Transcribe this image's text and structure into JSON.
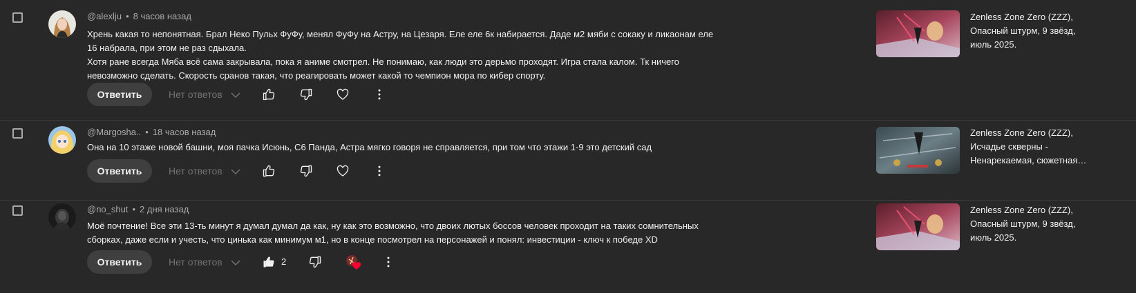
{
  "comments": [
    {
      "author": "@alexlju",
      "time": "8 часов назад",
      "text_lines": [
        "Хрень какая то непонятная. Брал Неко Пульх ФуФу, менял ФуФу на Астру, на Цезаря. Еле еле 6к набирается. Даде м2 мяби с сокаку и ликаонам еле 16 набрала, при этом не раз сдыхала.",
        "Хотя ране всегда Мяба всё сама закрывала, пока я аниме смотрел. Не понимаю, как люди это дерьмо проходят. Игра стала калом. Тк ничего невозможно сделать. Скорость сранов такая, что реагировать может какой то чемпион мора по кибер спорту."
      ],
      "reply_label": "Ответить",
      "replies_label": "Нет ответов",
      "video_title": "Zenless Zone Zero (ZZZ), Опасный штурм, 9 звёзд, июль 2025."
    },
    {
      "author": "@Margosha..",
      "time": "18 часов назад",
      "text_lines": [
        "Она на 10 этаже новой башни, моя пачка Исюнь, С6 Панда, Астра мягко говоря не справляется, при том что этажи 1-9 это детский сад"
      ],
      "reply_label": "Ответить",
      "replies_label": "Нет ответов",
      "video_title": "Zenless Zone Zero (ZZZ), Исчадье скверны - Ненарекаемая, сюжетная…"
    },
    {
      "author": "@no_shut",
      "time": "2 дня назад",
      "text_lines": [
        "Моё почтение! Все эти 13-ть минут я думал думал да как, ну как это возможно, что двоих лютых боссов человек проходит на таких сомнительных сборках, даже если и учесть, что цинька как минимум м1, но в конце посмотрел на персонажей и понял: инвестиции - ключ к победе XD"
      ],
      "reply_label": "Ответить",
      "replies_label": "Нет ответов",
      "like_count": "2",
      "video_title": "Zenless Zone Zero (ZZZ), Опасный штурм, 9 звёзд, июль 2025."
    }
  ],
  "icons": {
    "like": "thumbs-up-icon",
    "dislike": "thumbs-down-icon",
    "heart": "heart-icon",
    "more": "more-vert-icon",
    "chevron": "chevron-down-icon"
  },
  "colors": {
    "background": "#282828",
    "text": "#f1f1f1",
    "secondary_text": "#aaaaaa",
    "muted_text": "#717171",
    "button_bg": "#3f3f3f",
    "heart_badge": "#ff0033"
  }
}
